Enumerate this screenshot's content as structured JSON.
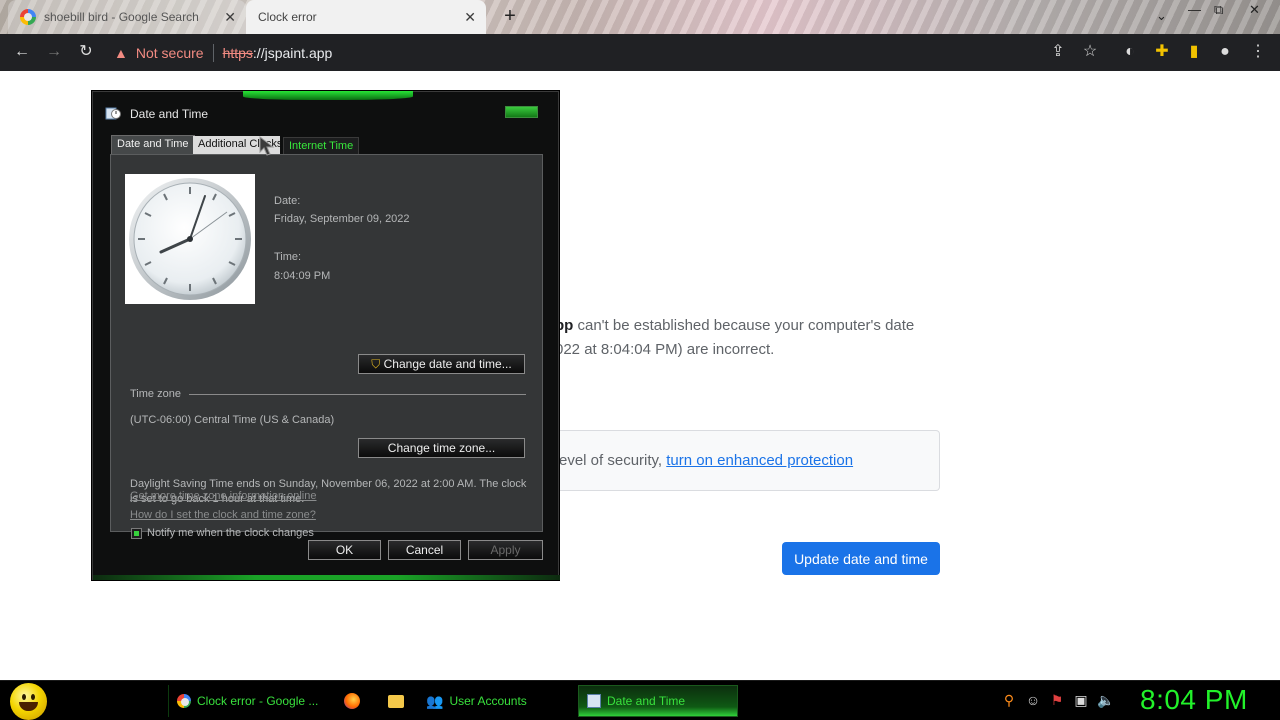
{
  "browser": {
    "tabs": [
      {
        "title": "shoebill bird - Google Search",
        "active": false
      },
      {
        "title": "Clock error",
        "active": true
      }
    ],
    "new_tab": "+",
    "window_controls": {
      "minimize": "⌄",
      "restore": "⧉",
      "close": "✕"
    },
    "omnibox": {
      "security_label": "Not secure",
      "url_scheme": "https",
      "url_rest": "://jspaint.app"
    }
  },
  "error_page": {
    "body_line1_bold": "pp",
    "body_line1_rest": " can't be established because your computer's date",
    "body_line2": "022 at 8:04:04 PM) are incorrect.",
    "security_prefix": "evel of security, ",
    "security_link": "turn on enhanced protection",
    "update_button": "Update date and time"
  },
  "dialog": {
    "title": "Date and Time",
    "tabs": [
      "Date and Time",
      "Additional Clocks",
      "Internet Time"
    ],
    "date_label": "Date:",
    "date_value": "Friday, September 09, 2022",
    "time_label": "Time:",
    "time_value": "8:04:09 PM",
    "change_datetime_button": "Change date and time...",
    "timezone_label": "Time zone",
    "timezone_value": "(UTC-06:00) Central Time (US & Canada)",
    "change_timezone_button": "Change time zone...",
    "dst_text": "Daylight Saving Time ends on Sunday, November 06, 2022 at 2:00 AM. The clock is set to go back 1 hour at that time.",
    "notify_label": "Notify me when the clock changes",
    "notify_checked": true,
    "link_more_info": "Get more time zone information online",
    "link_how_to": "How do I set the clock and time zone?",
    "ok_button": "OK",
    "cancel_button": "Cancel",
    "apply_button": "Apply"
  },
  "taskbar": {
    "items": [
      {
        "label": "Clock error - Google ...",
        "icon": "chrome-icon"
      },
      {
        "label": "",
        "icon": "firefox-icon"
      },
      {
        "label": "",
        "icon": "folder-icon"
      },
      {
        "label": "User Accounts",
        "icon": "user-accounts-icon"
      },
      {
        "label": "Date and Time",
        "icon": "date-time-icon"
      }
    ],
    "clock": "8:04 PM"
  },
  "colors": {
    "accent_green": "#22f22a",
    "link_blue": "#1a73e8",
    "warning_red": "#f28b82"
  }
}
